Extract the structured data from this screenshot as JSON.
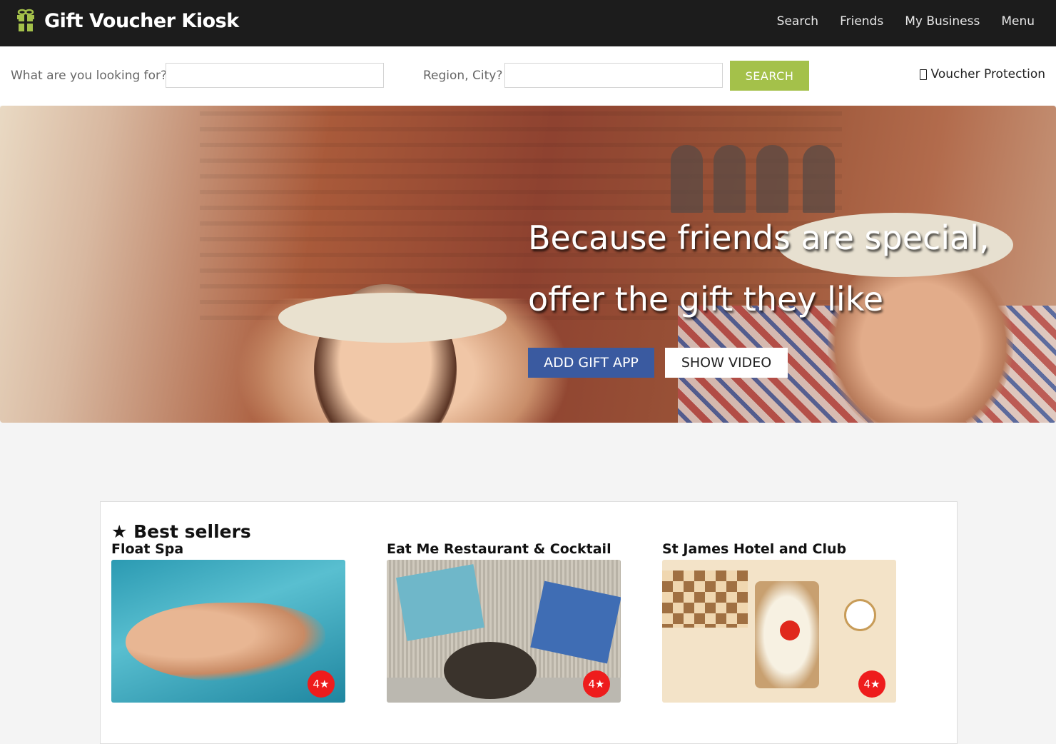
{
  "header": {
    "brand_title": "Gift Voucher Kiosk",
    "brand_icon": "gift-icon",
    "nav": [
      "Search",
      "Friends",
      "My Business",
      "Menu"
    ]
  },
  "search": {
    "what_label": "What are you looking for?",
    "what_value": "",
    "region_label": "Region, City?",
    "region_value": "",
    "button_label": "SEARCH",
    "protection_label": "Voucher Protection",
    "protection_icon": "shield-icon"
  },
  "hero": {
    "line1": "Because friends are special,",
    "line2": "offer the gift they like",
    "add_button": "ADD GIFT APP",
    "video_button": "SHOW VIDEO"
  },
  "best_sellers": {
    "title": "★ Best sellers",
    "items": [
      {
        "name": "Float Spa",
        "rating": "4★"
      },
      {
        "name": "Eat Me Restaurant & Cocktail",
        "rating": "4★"
      },
      {
        "name": "St James Hotel and Club",
        "rating": "4★"
      }
    ]
  },
  "colors": {
    "topbar": "#1c1c1c",
    "accent_green": "#a4c14a",
    "primary_blue": "#3a5aa0",
    "rating_red": "#ee1c1c"
  }
}
